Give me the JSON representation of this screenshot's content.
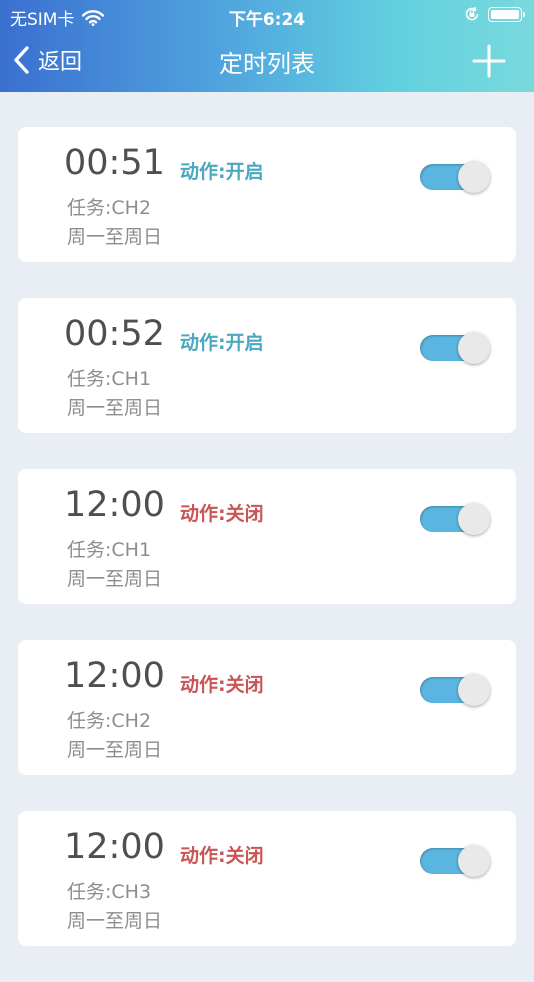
{
  "status_bar": {
    "carrier": "无SIM卡",
    "time": "下午6:24",
    "icons": [
      "wifi-icon",
      "orientation-lock-icon",
      "battery-icon"
    ]
  },
  "nav": {
    "back_label": "返回",
    "title": "定时列表",
    "add_icon": "plus-icon"
  },
  "colors": {
    "header_gradient": [
      "#3a6fd0",
      "#62d1df"
    ],
    "action_on": "#4aa8c0",
    "action_off": "#c95555",
    "toggle_on": "#5ab6e0",
    "background": "#e9eef4"
  },
  "timers": [
    {
      "time": "00:51",
      "action": "动作:开启",
      "action_state": "on",
      "task": "任务:CH2",
      "days": "周一至周日",
      "enabled": true
    },
    {
      "time": "00:52",
      "action": "动作:开启",
      "action_state": "on",
      "task": "任务:CH1",
      "days": "周一至周日",
      "enabled": true
    },
    {
      "time": "12:00",
      "action": "动作:关闭",
      "action_state": "off",
      "task": "任务:CH1",
      "days": "周一至周日",
      "enabled": true
    },
    {
      "time": "12:00",
      "action": "动作:关闭",
      "action_state": "off",
      "task": "任务:CH2",
      "days": "周一至周日",
      "enabled": true
    },
    {
      "time": "12:00",
      "action": "动作:关闭",
      "action_state": "off",
      "task": "任务:CH3",
      "days": "周一至周日",
      "enabled": true
    }
  ]
}
